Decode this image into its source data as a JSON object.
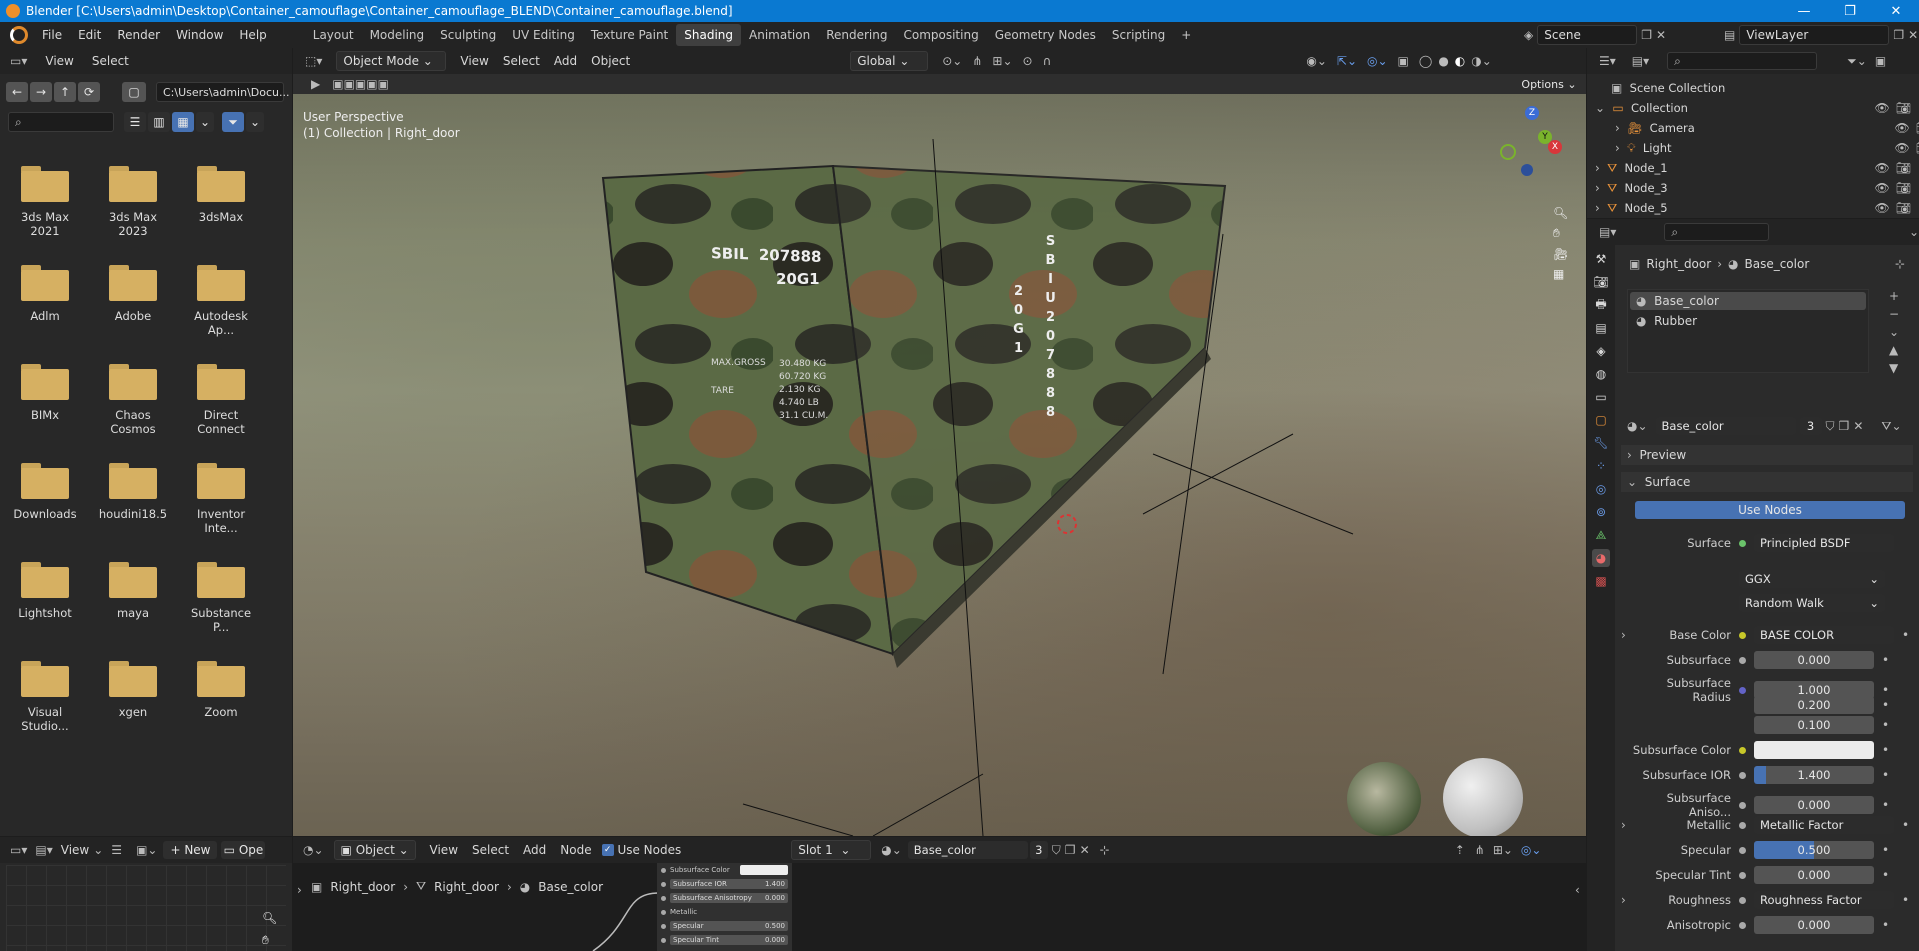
{
  "window": {
    "title": "Blender [C:\\Users\\admin\\Desktop\\Container_camouflage\\Container_camouflage_BLEND\\Container_camouflage.blend]",
    "minimize": "—",
    "maximize": "❐",
    "close": "✕"
  },
  "menu": [
    "File",
    "Edit",
    "Render",
    "Window",
    "Help"
  ],
  "workspaces": [
    "Layout",
    "Modeling",
    "Sculpting",
    "UV Editing",
    "Texture Paint",
    "Shading",
    "Animation",
    "Rendering",
    "Compositing",
    "Geometry Nodes",
    "Scripting",
    "+"
  ],
  "active_workspace": "Shading",
  "scene": {
    "name": "Scene",
    "view_layer": "ViewLayer"
  },
  "file_browser": {
    "header": {
      "view": "View",
      "select": "Select"
    },
    "path": "C:\\Users\\admin\\Docu...",
    "folders": [
      "3ds Max 2021",
      "3ds Max 2023",
      "3dsMax",
      "Adlm",
      "Adobe",
      "Autodesk Ap...",
      "BIMx",
      "Chaos Cosmos",
      "Direct Connect",
      "Downloads",
      "houdini18.5",
      "Inventor Inte...",
      "Lightshot",
      "maya",
      "Substance P...",
      "Visual Studio...",
      "xgen",
      "Zoom"
    ]
  },
  "viewport": {
    "mode": "Object Mode",
    "menus": [
      "View",
      "Select",
      "Add",
      "Object"
    ],
    "orientation": "Global",
    "options": "Options",
    "overlay_title": "User Perspective",
    "overlay_sub": "(1) Collection | Right_door",
    "axis": {
      "z": "Z",
      "y": "Y",
      "x": "X"
    }
  },
  "container_text": {
    "code": "SBIL",
    "number": "207888",
    "type": "20G1",
    "max_gross": "MAX.GROSS",
    "tare": "TARE",
    "weights": [
      "30.480 KG",
      "60.720 KG",
      "2.130 KG",
      "4.740 LB",
      "31.1 CU.M."
    ],
    "vertical_code": "SBIU207888",
    "vertical_type": "20G1"
  },
  "outliner": {
    "root": "Scene Collection",
    "items": [
      {
        "label": "Collection",
        "level": 1
      },
      {
        "label": "Camera",
        "level": 2
      },
      {
        "label": "Light",
        "level": 2
      },
      {
        "label": "Node_1",
        "level": 1
      },
      {
        "label": "Node_3",
        "level": 1
      },
      {
        "label": "Node_5",
        "level": 1
      }
    ]
  },
  "properties": {
    "breadcrumb": {
      "object": "Right_door",
      "material": "Base_color"
    },
    "slots": [
      "Base_color",
      "Rubber"
    ],
    "material_name": "Base_color",
    "users": "3",
    "sections": {
      "preview": "Preview",
      "surface": "Surface"
    },
    "use_nodes": "Use Nodes",
    "surface_label": "Surface",
    "surface_value": "Principled BSDF",
    "distribution": "GGX",
    "subsurface_method": "Random Walk",
    "rows": [
      {
        "label": "Base Color",
        "value": "BASE COLOR",
        "kind": "link",
        "dot": "y",
        "expand": true
      },
      {
        "label": "Subsurface",
        "value": "0.000",
        "kind": "num",
        "dot": "g"
      },
      {
        "label": "Subsurface Radius",
        "value": "1.000",
        "kind": "num",
        "dot": "b"
      },
      {
        "label": "",
        "value": "0.200",
        "kind": "num"
      },
      {
        "label": "",
        "value": "0.100",
        "kind": "num"
      },
      {
        "label": "Subsurface Color",
        "value": "",
        "kind": "color",
        "dot": "y"
      },
      {
        "label": "Subsurface IOR",
        "value": "1.400",
        "kind": "num",
        "dot": "g",
        "fill": 0.1
      },
      {
        "label": "Subsurface Aniso...",
        "value": "0.000",
        "kind": "num",
        "dot": "g"
      },
      {
        "label": "Metallic",
        "value": "Metallic Factor",
        "kind": "link",
        "dot": "g",
        "expand": true
      },
      {
        "label": "Specular",
        "value": "0.500",
        "kind": "num",
        "dot": "g",
        "fill": 0.5
      },
      {
        "label": "Specular Tint",
        "value": "0.000",
        "kind": "num",
        "dot": "g"
      },
      {
        "label": "Roughness",
        "value": "Roughness Factor",
        "kind": "link",
        "dot": "g",
        "expand": true
      },
      {
        "label": "Anisotropic",
        "value": "0.000",
        "kind": "num",
        "dot": "g"
      }
    ]
  },
  "shader_editor": {
    "object_type": "Object",
    "menus": [
      "View",
      "Select",
      "Add",
      "Node"
    ],
    "use_nodes": "Use Nodes",
    "slot": "Slot 1",
    "material": "Base_color",
    "users": "3",
    "breadcrumb": [
      "Right_door",
      "Right_door",
      "Base_color"
    ],
    "node_rows": [
      {
        "label": "Subsurface Color",
        "value": ""
      },
      {
        "label": "Subsurface IOR",
        "value": "1.400"
      },
      {
        "label": "Subsurface Anisotropy",
        "value": "0.000"
      },
      {
        "label": "Metallic",
        "value": ""
      },
      {
        "label": "Specular",
        "value": "0.500"
      },
      {
        "label": "Specular Tint",
        "value": "0.000"
      }
    ]
  },
  "image_editor": {
    "view": "View",
    "new": "New",
    "open": "Ope"
  }
}
